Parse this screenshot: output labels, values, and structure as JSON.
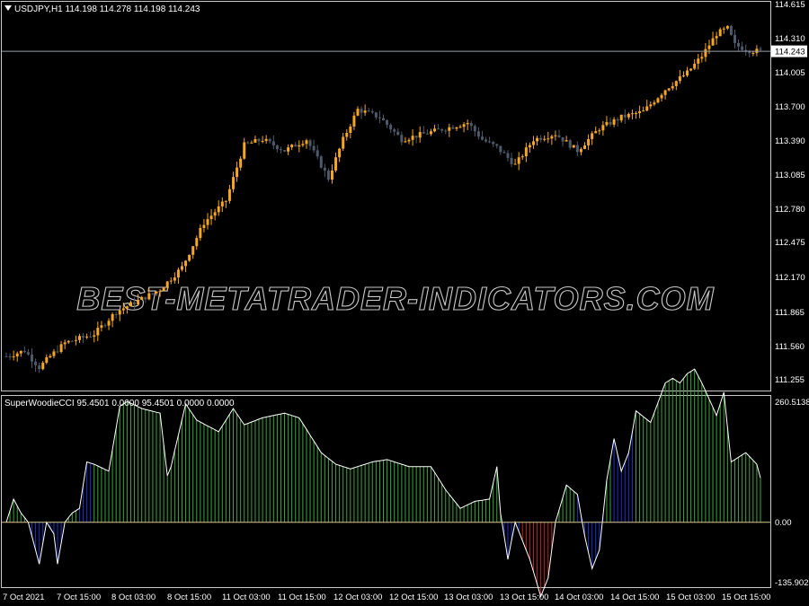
{
  "colors": {
    "background": "#000000",
    "frame": "#c8c8c8",
    "bull_candle": "#f5a623",
    "bear_candle": "#4e5a6b",
    "cci_line": "#ffffff",
    "hist_green": "#3aa63a",
    "hist_blue": "#1e32c8",
    "hist_red": "#c81e1e",
    "hist_neutral": "#d8c890",
    "price_label_bg": "#ffffff",
    "price_label_fg": "#000000"
  },
  "main": {
    "header": "USDJPY,H1  114.198 114.278 114.198 114.243",
    "current_price": "114.243",
    "watermark": "BEST-METATRADER-INDICATORS.COM",
    "y_ticks": [
      "114.615",
      "114.310",
      "114.005",
      "113.700",
      "113.390",
      "113.085",
      "112.780",
      "112.475",
      "112.170",
      "111.865",
      "111.560",
      "111.255"
    ]
  },
  "indicator": {
    "header": "SuperWoodieCCI 95.4501 0.0000 95.4501 0.0000 0.0000",
    "y_ticks": [
      "260.5138",
      "0.00",
      "-135.9023"
    ]
  },
  "x_ticks": [
    "7 Oct 2021",
    "7 Oct 15:00",
    "8 Oct 03:00",
    "8 Oct 15:00",
    "11 Oct 03:00",
    "11 Oct 15:00",
    "12 Oct 03:00",
    "12 Oct 15:00",
    "13 Oct 03:00",
    "13 Oct 15:00",
    "14 Oct 03:00",
    "14 Oct 15:00",
    "15 Oct 03:00",
    "15 Oct 15:00"
  ],
  "chart_data": [
    {
      "type": "candlestick",
      "title": "USDJPY,H1",
      "ylim": [
        111.2,
        114.68
      ],
      "price_anchors": [
        [
          0,
          111.5
        ],
        [
          5,
          111.55
        ],
        [
          9,
          111.4
        ],
        [
          12,
          111.5
        ],
        [
          16,
          111.62
        ],
        [
          24,
          111.7
        ],
        [
          30,
          111.9
        ],
        [
          36,
          112.0
        ],
        [
          42,
          112.1
        ],
        [
          48,
          112.3
        ],
        [
          54,
          112.7
        ],
        [
          60,
          112.9
        ],
        [
          65,
          113.4
        ],
        [
          70,
          113.45
        ],
        [
          76,
          113.35
        ],
        [
          82,
          113.45
        ],
        [
          88,
          113.1
        ],
        [
          92,
          113.45
        ],
        [
          96,
          113.72
        ],
        [
          102,
          113.65
        ],
        [
          108,
          113.45
        ],
        [
          114,
          113.5
        ],
        [
          120,
          113.55
        ],
        [
          126,
          113.6
        ],
        [
          130,
          113.45
        ],
        [
          134,
          113.38
        ],
        [
          139,
          113.22
        ],
        [
          144,
          113.45
        ],
        [
          150,
          113.5
        ],
        [
          156,
          113.35
        ],
        [
          162,
          113.55
        ],
        [
          168,
          113.65
        ],
        [
          174,
          113.7
        ],
        [
          180,
          113.9
        ],
        [
          186,
          114.05
        ],
        [
          190,
          114.2
        ],
        [
          194,
          114.4
        ],
        [
          197,
          114.45
        ],
        [
          199,
          114.3
        ],
        [
          203,
          114.25
        ],
        [
          206,
          114.243
        ]
      ]
    },
    {
      "type": "histogram",
      "title": "SuperWoodieCCI",
      "ylim": [
        -135.9023,
        260.5138
      ],
      "series_anchors": [
        [
          0,
          0
        ],
        [
          2,
          50
        ],
        [
          4,
          20
        ],
        [
          6,
          0
        ],
        [
          9,
          -90
        ],
        [
          11,
          0
        ],
        [
          13,
          -25
        ],
        [
          14,
          -90
        ],
        [
          16,
          0
        ],
        [
          18,
          20
        ],
        [
          20,
          30
        ],
        [
          22,
          130
        ],
        [
          24,
          125
        ],
        [
          28,
          110
        ],
        [
          31,
          250
        ],
        [
          33,
          260
        ],
        [
          37,
          245
        ],
        [
          42,
          235
        ],
        [
          44,
          100
        ],
        [
          45,
          120
        ],
        [
          49,
          255
        ],
        [
          52,
          220
        ],
        [
          58,
          195
        ],
        [
          62,
          245
        ],
        [
          65,
          210
        ],
        [
          70,
          225
        ],
        [
          76,
          235
        ],
        [
          80,
          225
        ],
        [
          86,
          150
        ],
        [
          90,
          125
        ],
        [
          94,
          115
        ],
        [
          100,
          130
        ],
        [
          104,
          135
        ],
        [
          110,
          120
        ],
        [
          116,
          120
        ],
        [
          120,
          70
        ],
        [
          124,
          30
        ],
        [
          128,
          45
        ],
        [
          132,
          50
        ],
        [
          134,
          120
        ],
        [
          135,
          20
        ],
        [
          137,
          -80
        ],
        [
          139,
          0
        ],
        [
          141,
          -40
        ],
        [
          143,
          -80
        ],
        [
          146,
          -160
        ],
        [
          148,
          -120
        ],
        [
          150,
          0
        ],
        [
          153,
          80
        ],
        [
          156,
          60
        ],
        [
          158,
          -30
        ],
        [
          160,
          -100
        ],
        [
          162,
          -60
        ],
        [
          164,
          90
        ],
        [
          166,
          180
        ],
        [
          168,
          110
        ],
        [
          170,
          150
        ],
        [
          172,
          240
        ],
        [
          176,
          215
        ],
        [
          180,
          300
        ],
        [
          182,
          310
        ],
        [
          184,
          300
        ],
        [
          186,
          320
        ],
        [
          188,
          330
        ],
        [
          190,
          300
        ],
        [
          194,
          230
        ],
        [
          196,
          280
        ],
        [
          198,
          130
        ],
        [
          200,
          140
        ],
        [
          202,
          150
        ],
        [
          205,
          125
        ],
        [
          206,
          95.4501
        ]
      ]
    }
  ]
}
